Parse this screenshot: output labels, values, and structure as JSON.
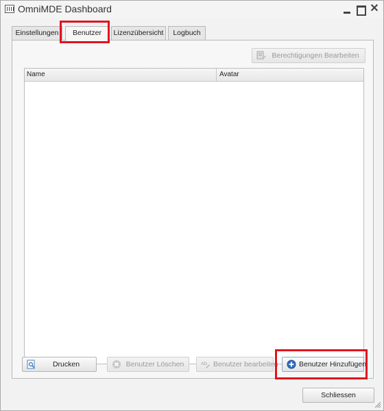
{
  "window": {
    "title": "OmniMDE Dashboard",
    "controls": {
      "minimize": "",
      "maximize": "",
      "close": "✕"
    }
  },
  "tabs": [
    {
      "label": "Einstellungen",
      "active": false
    },
    {
      "label": "Benutzer",
      "active": true
    },
    {
      "label": "Lizenzübersicht",
      "active": false
    },
    {
      "label": "Logbuch",
      "active": false
    }
  ],
  "toolbar": {
    "edit_rights_label": "Berechtigungen Bearbeiten",
    "edit_rights_enabled": false
  },
  "table": {
    "columns": [
      "Name",
      "Avatar"
    ],
    "rows": []
  },
  "actions": {
    "print_label": "Drucken",
    "delete_user_label": "Benutzer Löschen",
    "edit_user_label": "Benutzer bearbeiten",
    "add_user_label": "Benutzer Hinzufügen"
  },
  "footer": {
    "close_label": "Schliessen"
  },
  "colors": {
    "highlight": "#e0141e",
    "accent": "#2d6fc2"
  }
}
